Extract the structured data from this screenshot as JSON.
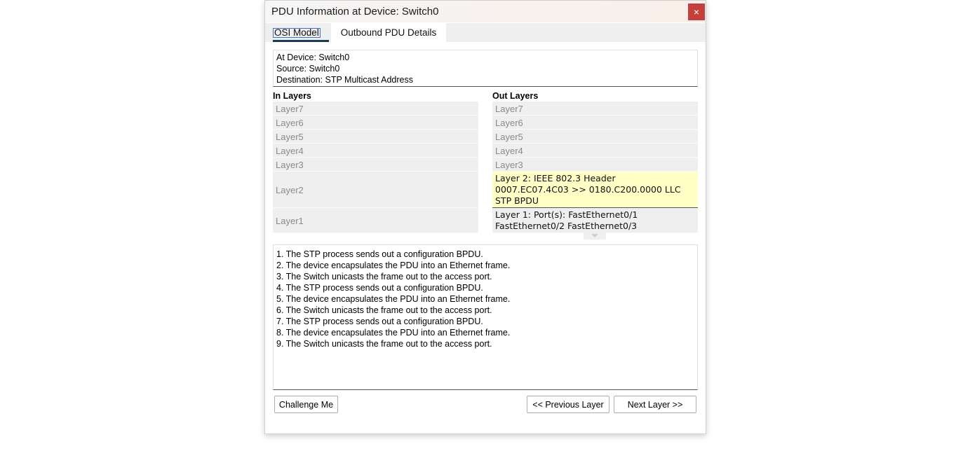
{
  "window": {
    "title": "PDU Information at Device: Switch0",
    "close_symbol": "×"
  },
  "tabs": [
    {
      "label": "OSI Model"
    },
    {
      "label": "Outbound PDU Details"
    }
  ],
  "info": {
    "device": "At Device: Switch0",
    "source": "Source: Switch0",
    "destination": "Destination: STP Multicast Address"
  },
  "in_layers": {
    "heading": "In Layers",
    "items": [
      "Layer7",
      "Layer6",
      "Layer5",
      "Layer4",
      "Layer3",
      "Layer2",
      "Layer1"
    ]
  },
  "out_layers": {
    "heading": "Out Layers",
    "items": [
      "Layer7",
      "Layer6",
      "Layer5",
      "Layer4",
      "Layer3"
    ],
    "layer2": [
      "Layer 2: IEEE 802.3 Header",
      "0007.EC07.4C03 >> 0180.C200.0000 LLC",
      "STP BPDU"
    ],
    "layer1": [
      "Layer 1: Port(s): FastEthernet0/1",
      "FastEthernet0/2 FastEthernet0/3"
    ]
  },
  "steps": [
    "1. The STP process sends out a configuration BPDU.",
    "2. The device encapsulates the PDU into an Ethernet frame.",
    "3. The Switch unicasts the frame out to the access port.",
    "4. The STP process sends out a configuration BPDU.",
    "5. The device encapsulates the PDU into an Ethernet frame.",
    "6. The Switch unicasts the frame out to the access port.",
    "7. The STP process sends out a configuration BPDU.",
    "8. The device encapsulates the PDU into an Ethernet frame.",
    "9. The Switch unicasts the frame out to the access port."
  ],
  "buttons": {
    "challenge": "Challenge Me",
    "previous": "<< Previous Layer",
    "next": "Next Layer >>"
  }
}
